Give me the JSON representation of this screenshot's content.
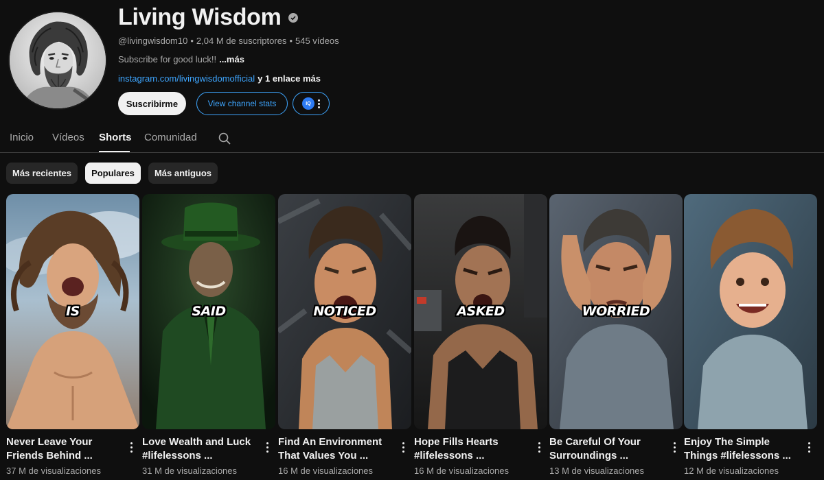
{
  "channel": {
    "name": "Living Wisdom",
    "handle": "@livingwisdom10",
    "subscribers": "2,04 M de suscriptores",
    "videos": "545 vídeos",
    "separator": "•",
    "description": "Subscribe for good luck!!",
    "description_more": "...más",
    "link": "instagram.com/livingwisdomofficial",
    "link_extra": "y 1 enlace más",
    "subscribe_label": "Suscribirme",
    "stats_label": "View channel stats",
    "iq_label": "IQ"
  },
  "tabs": [
    {
      "label": "Inicio",
      "active": false
    },
    {
      "label": "Vídeos",
      "active": false
    },
    {
      "label": "Shorts",
      "active": true
    },
    {
      "label": "Comunidad",
      "active": false
    }
  ],
  "filters": [
    {
      "label": "Más recientes",
      "active": false
    },
    {
      "label": "Populares",
      "active": true
    },
    {
      "label": "Más antiguos",
      "active": false
    }
  ],
  "shorts": [
    {
      "caption": "IS",
      "title_line1": "Never Leave Your",
      "title_line2": "Friends Behind ...",
      "views": "37 M de visualizaciones"
    },
    {
      "caption": "SAID",
      "title_line1": "Love Wealth and Luck",
      "title_line2": "#lifelessons ...",
      "views": "31 M de visualizaciones"
    },
    {
      "caption": "NOTICED",
      "title_line1": "Find An Environment",
      "title_line2": "That Values You ...",
      "views": "16 M de visualizaciones"
    },
    {
      "caption": "ASKED",
      "title_line1": "Hope Fills Hearts",
      "title_line2": "#lifelessons ...",
      "views": "16 M de visualizaciones"
    },
    {
      "caption": "WORRIED",
      "title_line1": "Be Careful Of Your",
      "title_line2": "Surroundings ...",
      "views": "13 M de visualizaciones"
    },
    {
      "caption": "",
      "title_line1": "Enjoy The Simple",
      "title_line2": "Things #lifelessons ...",
      "views": "12 M de visualizaciones"
    }
  ],
  "colors": {
    "background": "#0f0f0f",
    "text_primary": "#f1f1f1",
    "text_secondary": "#aaaaaa",
    "link": "#3ea6ff",
    "chip": "#272727"
  },
  "icons": {
    "verified": "verified-check-icon",
    "search": "search-icon",
    "more": "kebab-menu-icon",
    "iq": "iq-extension-icon"
  }
}
